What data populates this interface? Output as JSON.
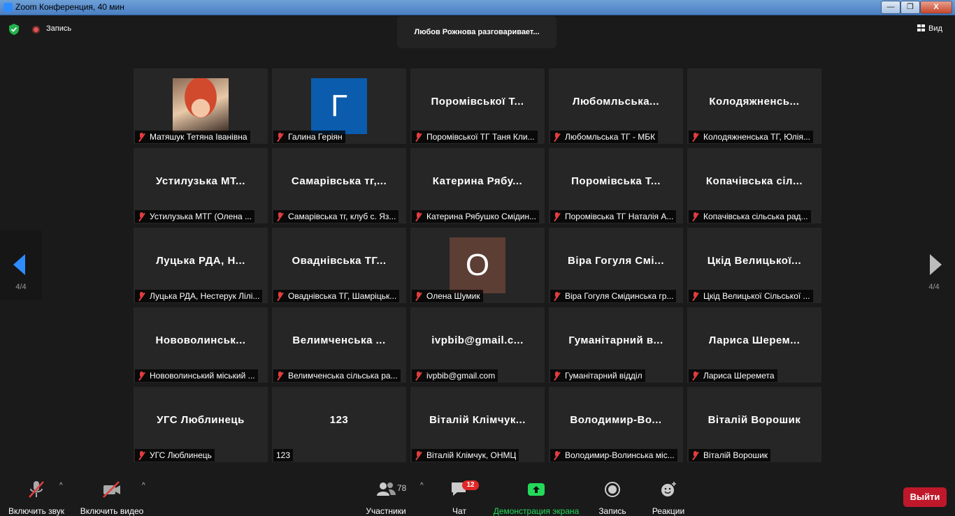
{
  "window": {
    "title": "Zoom Конференция, 40 мин",
    "buttons": [
      "—",
      "❐",
      "X"
    ]
  },
  "topbar": {
    "recording_label": "Запись",
    "talking": "Любов Рожнова разговаривает...",
    "view_label": "Вид"
  },
  "pager": {
    "left_label": "4/4",
    "right_label": "4/4"
  },
  "tiles": [
    {
      "big": "",
      "tag": "Матяшук Тетяна Іванівна",
      "muted": true,
      "kind": "photo"
    },
    {
      "big": "Г",
      "tag": "Галина Геріян",
      "muted": true,
      "kind": "avatar",
      "avatar_color": "#0b5cad"
    },
    {
      "big": "Поромівської Т...",
      "tag": "Поромівської ТГ Таня Кли...",
      "muted": true
    },
    {
      "big": "Любомльська...",
      "tag": "Любомльська ТГ - МБК",
      "muted": true
    },
    {
      "big": "Колодяжненсь...",
      "tag": "Колодяжненська ТГ, Юлія...",
      "muted": true
    },
    {
      "big": "Устилузька МТ...",
      "tag": "Устилузька МТГ  (Олена ...",
      "muted": true
    },
    {
      "big": "Самарівська тг,...",
      "tag": "Самарівська тг, клуб с. Яз...",
      "muted": true
    },
    {
      "big": "Катерина Рябу...",
      "tag": "Катерина Рябушко Смідин...",
      "muted": true
    },
    {
      "big": "Поромівська Т...",
      "tag": "Поромівська ТГ Наталія А...",
      "muted": true
    },
    {
      "big": "Копачівська сіл...",
      "tag": "Копачівська сільська рад...",
      "muted": true
    },
    {
      "big": "Луцька РДА, Н...",
      "tag": "Луцька РДА, Нестерук Лілі...",
      "muted": true
    },
    {
      "big": "Оваднівська ТГ...",
      "tag": "Оваднівська ТГ, Шамріцьк...",
      "muted": true
    },
    {
      "big": "О",
      "tag": "Олена Шумик",
      "muted": true,
      "kind": "avatar",
      "avatar_color": "#5c3e34"
    },
    {
      "big": "Віра Гогуля Смі...",
      "tag": "Віра Гогуля Смідинська гр...",
      "muted": true
    },
    {
      "big": "Цкід Велицької...",
      "tag": "Цкід Велицької Сільської ...",
      "muted": true
    },
    {
      "big": "Нововолинськ...",
      "tag": "Нововолинський міський ...",
      "muted": true
    },
    {
      "big": "Велимченська ...",
      "tag": "Велимченська сільська ра...",
      "muted": true
    },
    {
      "big": "ivpbib@gmail.c...",
      "tag": "ivpbib@gmail.com",
      "muted": true
    },
    {
      "big": "Гуманітарний в...",
      "tag": "Гуманітарний відділ",
      "muted": true
    },
    {
      "big": "Лариса Шерем...",
      "tag": "Лариса Шеремета",
      "muted": true
    },
    {
      "big": "УГС Люблинець",
      "tag": "УГС Люблинець",
      "muted": true
    },
    {
      "big": "123",
      "tag": "123",
      "muted": false
    },
    {
      "big": "Віталій Клімчук...",
      "tag": "Віталій Клімчук, ОНМЦ",
      "muted": true
    },
    {
      "big": "Володимир-Во...",
      "tag": "Володимир-Волинська міс...",
      "muted": true
    },
    {
      "big": "Віталій Ворошик",
      "tag": "Віталій Ворошик",
      "muted": true
    }
  ],
  "toolbar": {
    "audio": "Включить звук",
    "video": "Включить видео",
    "participants": "Участники",
    "participants_count": "78",
    "chat": "Чат",
    "chat_badge": "12",
    "share": "Демонстрация экрана",
    "record": "Запись",
    "reactions": "Реакции",
    "leave": "Выйти"
  },
  "colors": {
    "share_green": "#23d959",
    "leave_red": "#c0182b",
    "accent_blue": "#2d8cff"
  }
}
